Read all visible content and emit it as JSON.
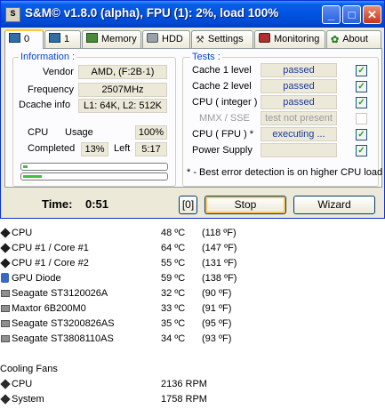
{
  "window": {
    "title": "S&M© v1.8.0 (alpha), FPU (1): 2%, load 100%",
    "icon_label": "S",
    "controls": {
      "minimize": "_",
      "maximize": "□",
      "close": "✕"
    }
  },
  "tabs": [
    {
      "label": "0"
    },
    {
      "label": "1"
    },
    {
      "label": "Memory"
    },
    {
      "label": "HDD"
    },
    {
      "label": "Settings"
    },
    {
      "label": "Monitoring"
    },
    {
      "label": "About"
    }
  ],
  "information": {
    "title": "Information :",
    "vendor_label": "Vendor",
    "vendor_value": "AMD,  (F:2B·1)",
    "frequency_label": "Frequency",
    "frequency_value": "2507MHz",
    "dcache_label": "Dcache info",
    "dcache_value": "L1: 64K, L2: 512K",
    "cpu_label": "CPU",
    "usage_label": "Usage",
    "usage_value": "100%",
    "completed_label": "Completed",
    "completed_value": "13%",
    "left_label": "Left",
    "left_value": "5:17",
    "progress_top_fraction": 0.03,
    "progress_bottom_fraction": 0.13
  },
  "tests": {
    "title": "Tests :",
    "items": [
      {
        "label": "Cache 1 level",
        "status": "passed",
        "checked": true
      },
      {
        "label": "Cache 2 level",
        "status": "passed",
        "checked": true
      },
      {
        "label": "CPU ( integer )",
        "status": "passed",
        "checked": true
      },
      {
        "label": "MMX / SSE",
        "status": "test not present",
        "checked": false
      },
      {
        "label": "CPU ( FPU ) *",
        "status": "executing ...",
        "checked": true
      },
      {
        "label": "Power Supply",
        "status": "",
        "checked": true
      }
    ],
    "note": "* - Best error detection is on higher CPU load"
  },
  "bottom": {
    "time_label": "Time:",
    "time_value": "0:51",
    "index_button": "[0]",
    "stop_button": "Stop",
    "wizard_button": "Wizard"
  },
  "temperatures": [
    {
      "name": "CPU",
      "celsius": "48 ºC",
      "fahrenheit": "(118 ºF)",
      "icon": "chip-icon"
    },
    {
      "name": "CPU #1 / Core #1",
      "celsius": "64 ºC",
      "fahrenheit": "(147 ºF)",
      "icon": "chip-icon"
    },
    {
      "name": "CPU #1 / Core #2",
      "celsius": "55 ºC",
      "fahrenheit": "(131 ºF)",
      "icon": "chip-icon"
    },
    {
      "name": "GPU Diode",
      "celsius": "59 ºC",
      "fahrenheit": "(138 ºF)",
      "icon": "gpu-icon"
    },
    {
      "name": "Seagate ST3120026A",
      "celsius": "32 ºC",
      "fahrenheit": "(90 ºF)",
      "icon": "hdd-icon"
    },
    {
      "name": "Maxtor 6B200M0",
      "celsius": "33 ºC",
      "fahrenheit": "(91 ºF)",
      "icon": "hdd-icon"
    },
    {
      "name": "Seagate ST3200826AS",
      "celsius": "35 ºC",
      "fahrenheit": "(95 ºF)",
      "icon": "hdd-icon"
    },
    {
      "name": "Seagate ST3808110AS",
      "celsius": "34 ºC",
      "fahrenheit": "(93 ºF)",
      "icon": "hdd-icon"
    }
  ],
  "cooling_fans": {
    "title": "Cooling Fans",
    "items": [
      {
        "name": "CPU",
        "value": "2136 RPM",
        "icon": "fan-icon"
      },
      {
        "name": "System",
        "value": "1758 RPM",
        "icon": "fan-icon"
      }
    ]
  }
}
